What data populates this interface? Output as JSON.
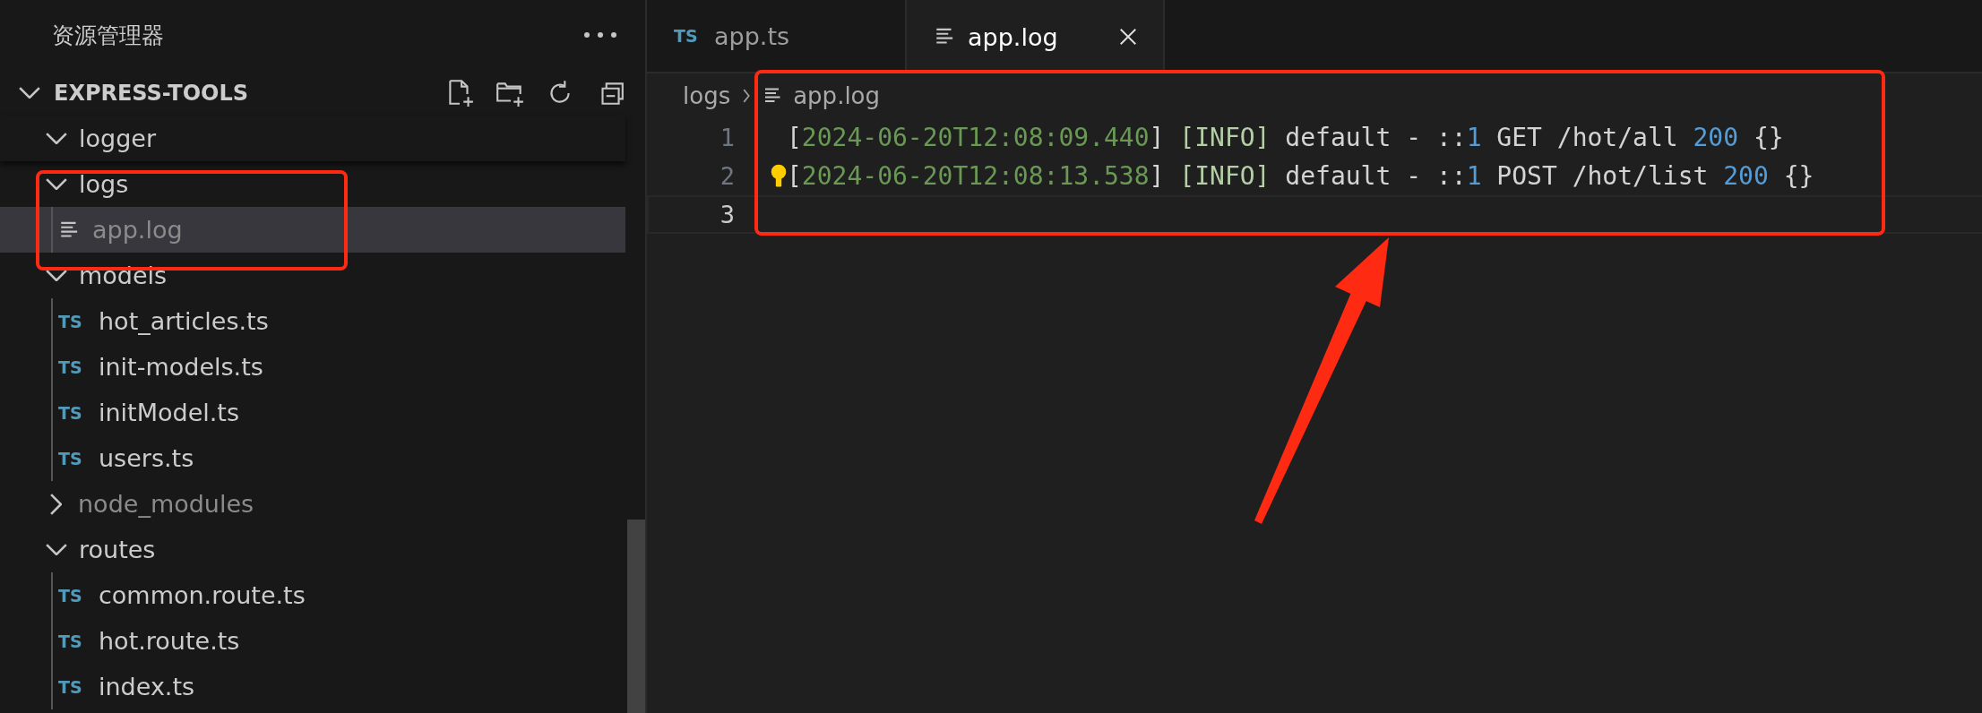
{
  "sidebar": {
    "title": "资源管理器",
    "root": {
      "label": "EXPRESS-TOOLS",
      "expanded": true
    },
    "tree": [
      {
        "label": "logger",
        "kind": "folder",
        "expanded": true,
        "selected": false,
        "dimmed": false
      },
      {
        "label": "logs",
        "kind": "folder",
        "expanded": true,
        "selected": false,
        "dimmed": false,
        "children": [
          {
            "label": "app.log",
            "kind": "log",
            "selected": true,
            "dimmed": true
          }
        ]
      },
      {
        "label": "models",
        "kind": "folder",
        "expanded": true,
        "selected": false,
        "dimmed": false,
        "children": [
          {
            "label": "hot_articles.ts",
            "kind": "ts",
            "badge": "TS",
            "selected": false,
            "dimmed": false
          },
          {
            "label": "init-models.ts",
            "kind": "ts",
            "badge": "TS",
            "selected": false,
            "dimmed": false
          },
          {
            "label": "initModel.ts",
            "kind": "ts",
            "badge": "TS",
            "selected": false,
            "dimmed": false
          },
          {
            "label": "users.ts",
            "kind": "ts",
            "badge": "TS",
            "selected": false,
            "dimmed": false
          }
        ]
      },
      {
        "label": "node_modules",
        "kind": "folder",
        "expanded": false,
        "selected": false,
        "dimmed": true
      },
      {
        "label": "routes",
        "kind": "folder",
        "expanded": true,
        "selected": false,
        "dimmed": false,
        "children": [
          {
            "label": "common.route.ts",
            "kind": "ts",
            "badge": "TS",
            "selected": false,
            "dimmed": false
          },
          {
            "label": "hot.route.ts",
            "kind": "ts",
            "badge": "TS",
            "selected": false,
            "dimmed": false
          },
          {
            "label": "index.ts",
            "kind": "ts",
            "badge": "TS",
            "selected": false,
            "dimmed": false
          }
        ]
      }
    ]
  },
  "tabs": [
    {
      "label": "app.ts",
      "kind": "ts",
      "badge": "TS",
      "selected": false
    },
    {
      "label": "app.log",
      "kind": "log",
      "selected": true
    }
  ],
  "breadcrumb": [
    {
      "label": "logs",
      "kind": "folder"
    },
    {
      "label": "app.log",
      "kind": "log"
    }
  ],
  "editor": {
    "lines": [
      {
        "number": "1",
        "current": false,
        "lightbulb": false,
        "tokens": [
          {
            "kind": "text",
            "text": "["
          },
          {
            "kind": "date",
            "text": "2024-06-20T12:08:09.440"
          },
          {
            "kind": "text",
            "text": "] "
          },
          {
            "kind": "tag",
            "text": "[INFO]"
          },
          {
            "kind": "text",
            "text": " default - ::"
          },
          {
            "kind": "number",
            "text": "1"
          },
          {
            "kind": "text",
            "text": " GET /hot/all "
          },
          {
            "kind": "number",
            "text": "200"
          },
          {
            "kind": "text",
            "text": " {}"
          }
        ]
      },
      {
        "number": "2",
        "current": false,
        "lightbulb": true,
        "tokens": [
          {
            "kind": "text",
            "text": "["
          },
          {
            "kind": "date",
            "text": "2024-06-20T12:08:13.538"
          },
          {
            "kind": "text",
            "text": "] "
          },
          {
            "kind": "tag",
            "text": "[INFO]"
          },
          {
            "kind": "text",
            "text": " default - ::"
          },
          {
            "kind": "number",
            "text": "1"
          },
          {
            "kind": "text",
            "text": " POST /hot/list "
          },
          {
            "kind": "number",
            "text": "200"
          },
          {
            "kind": "text",
            "text": " {}"
          }
        ]
      },
      {
        "number": "3",
        "current": true,
        "lightbulb": false
      }
    ]
  }
}
